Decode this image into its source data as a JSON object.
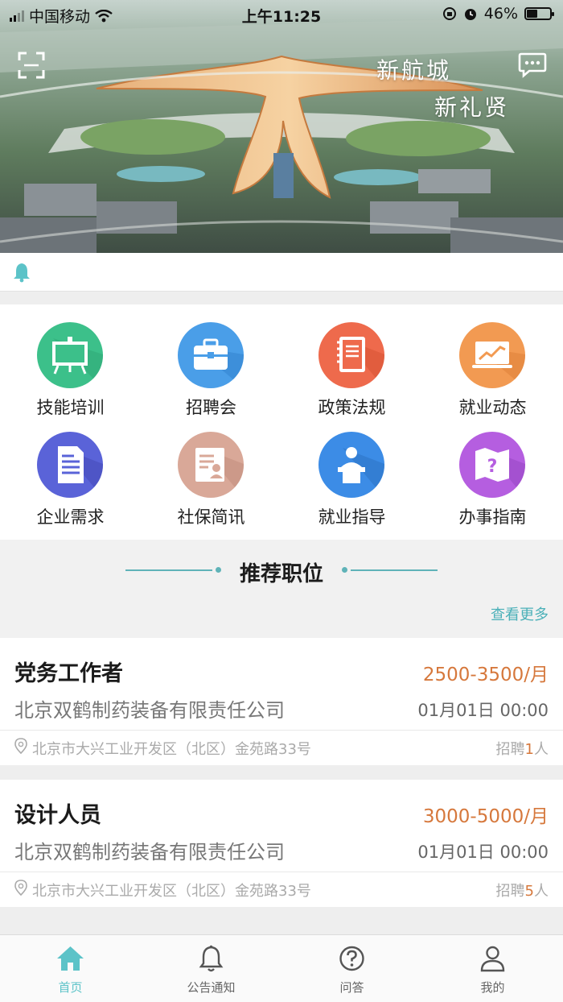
{
  "status_bar": {
    "carrier": "中国移动",
    "time": "上午11:25",
    "battery": "46%",
    "battery_level": 0.46
  },
  "hero": {
    "slogan_line1": "新航城",
    "slogan_line2": "新礼贤",
    "scan_icon": "scan-icon",
    "message_icon": "message-icon"
  },
  "notice": {
    "text": "",
    "icon": "bell-icon"
  },
  "grid": {
    "items": [
      {
        "label": "技能培训",
        "icon": "easel-icon",
        "color": "#3cc08a"
      },
      {
        "label": "招聘会",
        "icon": "briefcase-icon",
        "color": "#4a9ee8"
      },
      {
        "label": "政策法规",
        "icon": "notebook-icon",
        "color": "#ee6a4c"
      },
      {
        "label": "就业动态",
        "icon": "trend-chart-icon",
        "color": "#f29a52"
      },
      {
        "label": "企业需求",
        "icon": "document-icon",
        "color": "#5a63d8"
      },
      {
        "label": "社保简讯",
        "icon": "profile-card-icon",
        "color": "#d9a898"
      },
      {
        "label": "就业指导",
        "icon": "lecturer-icon",
        "color": "#3c8ce6"
      },
      {
        "label": "办事指南",
        "icon": "help-map-icon",
        "color": "#b55ee0"
      }
    ]
  },
  "section": {
    "title": "推荐职位",
    "more_label": "查看更多",
    "accent": "#5fb3b8"
  },
  "jobs": [
    {
      "title": "党务工作者",
      "salary": "2500-3500/月",
      "company": "北京双鹤制药装备有限责任公司",
      "date": "01月01日 00:00",
      "address": "北京市大兴工业开发区（北区）金苑路33号",
      "hire_prefix": "招聘",
      "hire_count": "1",
      "hire_suffix": "人"
    },
    {
      "title": "设计人员",
      "salary": "3000-5000/月",
      "company": "北京双鹤制药装备有限责任公司",
      "date": "01月01日 00:00",
      "address": "北京市大兴工业开发区（北区）金苑路33号",
      "hire_prefix": "招聘",
      "hire_count": "5",
      "hire_suffix": "人"
    }
  ],
  "tabbar": {
    "tabs": [
      {
        "label": "首页",
        "icon": "home-icon",
        "active": true
      },
      {
        "label": "公告通知",
        "icon": "bell-icon",
        "active": false
      },
      {
        "label": "问答",
        "icon": "question-icon",
        "active": false
      },
      {
        "label": "我的",
        "icon": "user-icon",
        "active": false
      }
    ],
    "active_color": "#5cc3c8"
  }
}
